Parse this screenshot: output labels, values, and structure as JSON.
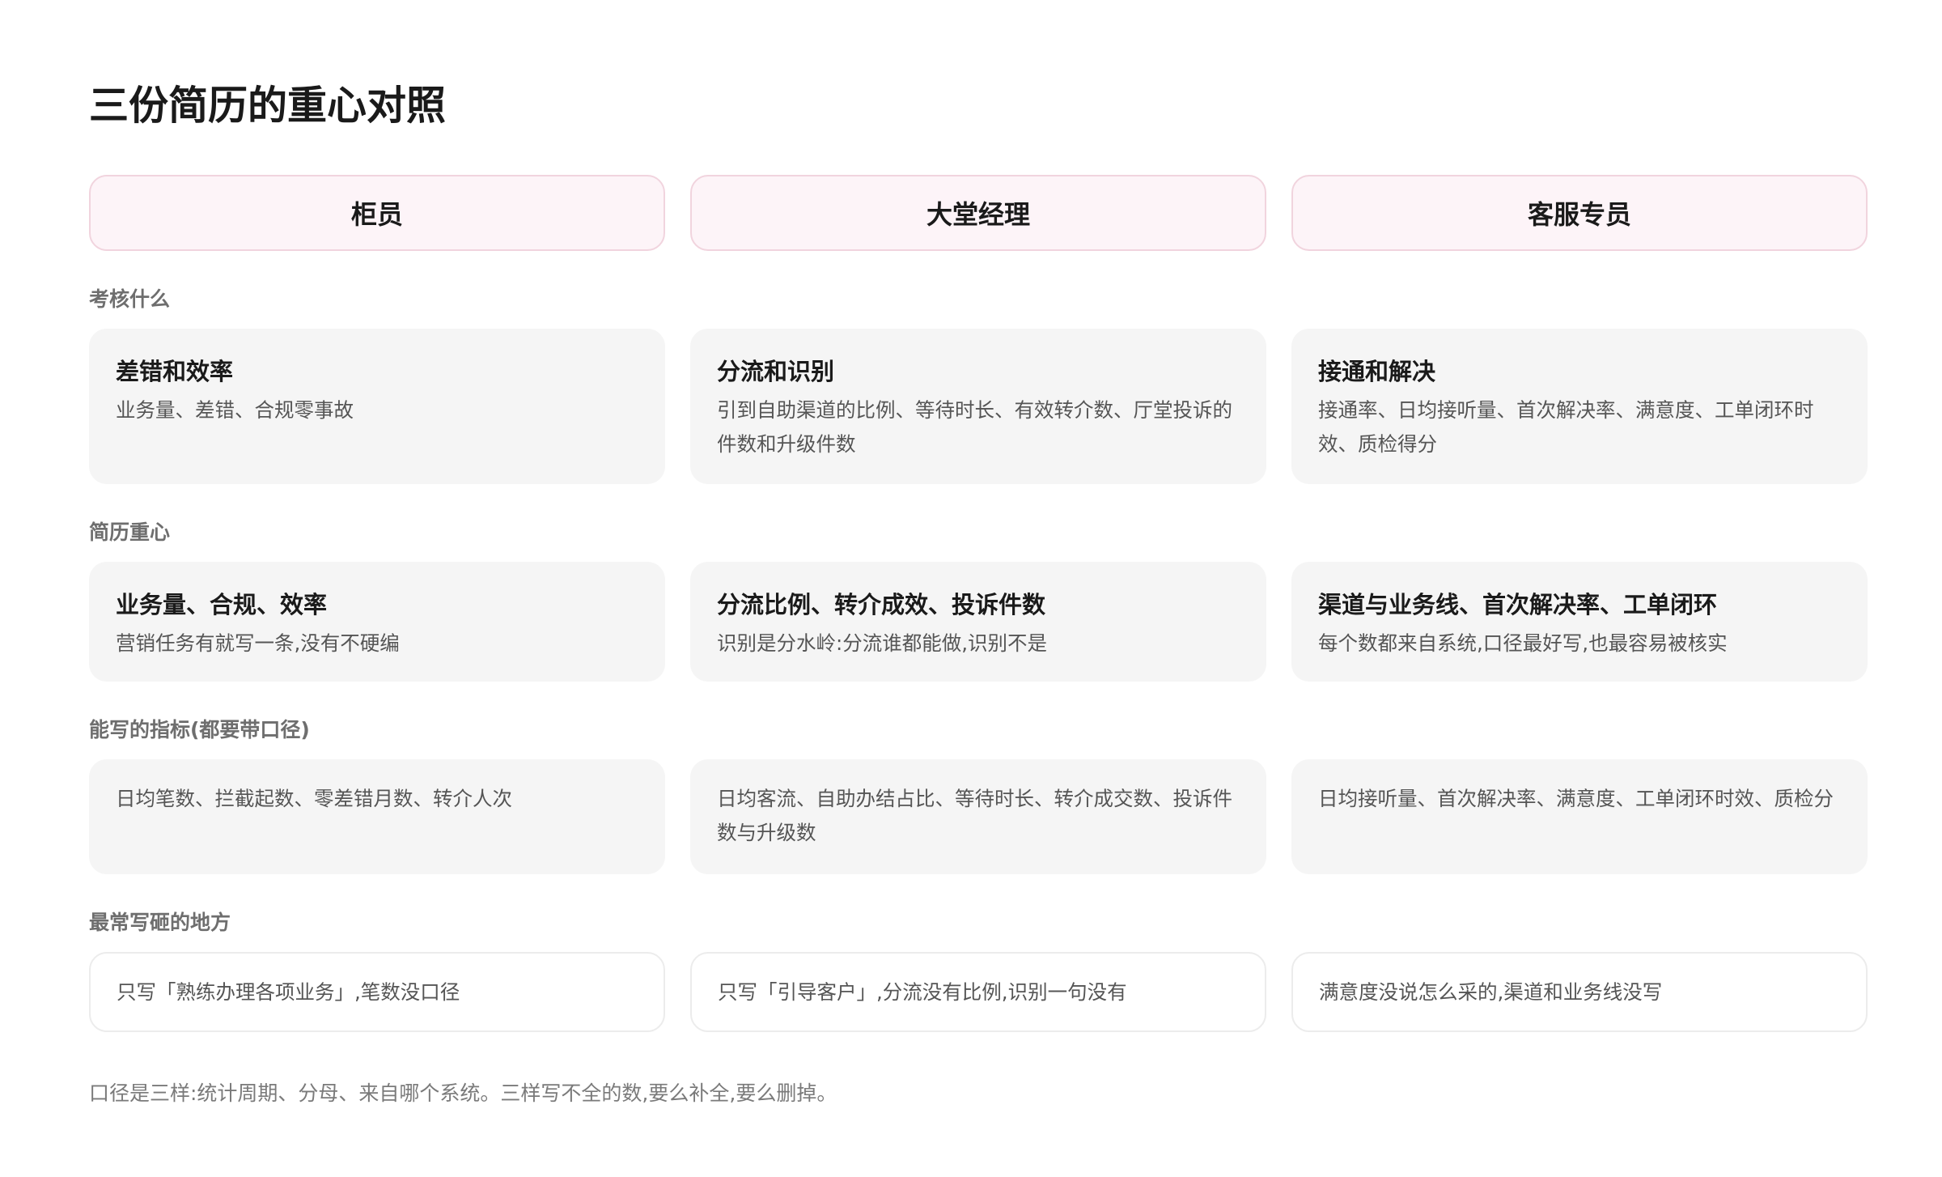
{
  "title": "三份简历的重心对照",
  "columns": [
    "柜员",
    "大堂经理",
    "客服专员"
  ],
  "sections": {
    "assess": {
      "label": "考核什么",
      "cards": [
        {
          "title": "差错和效率",
          "desc": "业务量、差错、合规零事故"
        },
        {
          "title": "分流和识别",
          "desc": "引到自助渠道的比例、等待时长、有效转介数、厅堂投诉的件数和升级件数"
        },
        {
          "title": "接通和解决",
          "desc": "接通率、日均接听量、首次解决率、满意度、工单闭环时效、质检得分"
        }
      ]
    },
    "focus": {
      "label": "简历重心",
      "cards": [
        {
          "title": "业务量、合规、效率",
          "desc": "营销任务有就写一条,没有不硬编"
        },
        {
          "title": "分流比例、转介成效、投诉件数",
          "desc": "识别是分水岭:分流谁都能做,识别不是"
        },
        {
          "title": "渠道与业务线、首次解决率、工单闭环",
          "desc": "每个数都来自系统,口径最好写,也最容易被核实"
        }
      ]
    },
    "metrics": {
      "label": "能写的指标(都要带口径)",
      "cards": [
        {
          "desc": "日均笔数、拦截起数、零差错月数、转介人次"
        },
        {
          "desc": "日均客流、自助办结占比、等待时长、转介成交数、投诉件数与升级数"
        },
        {
          "desc": "日均接听量、首次解决率、满意度、工单闭环时效、质检分"
        }
      ]
    },
    "pitfalls": {
      "label": "最常写砸的地方",
      "cards": [
        {
          "desc": "只写「熟练办理各项业务」,笔数没口径"
        },
        {
          "desc": "只写「引导客户」,分流没有比例,识别一句没有"
        },
        {
          "desc": "满意度没说怎么采的,渠道和业务线没写"
        }
      ]
    }
  },
  "footnote": "口径是三样:统计周期、分母、来自哪个系统。三样写不全的数,要么补全,要么删掉。"
}
